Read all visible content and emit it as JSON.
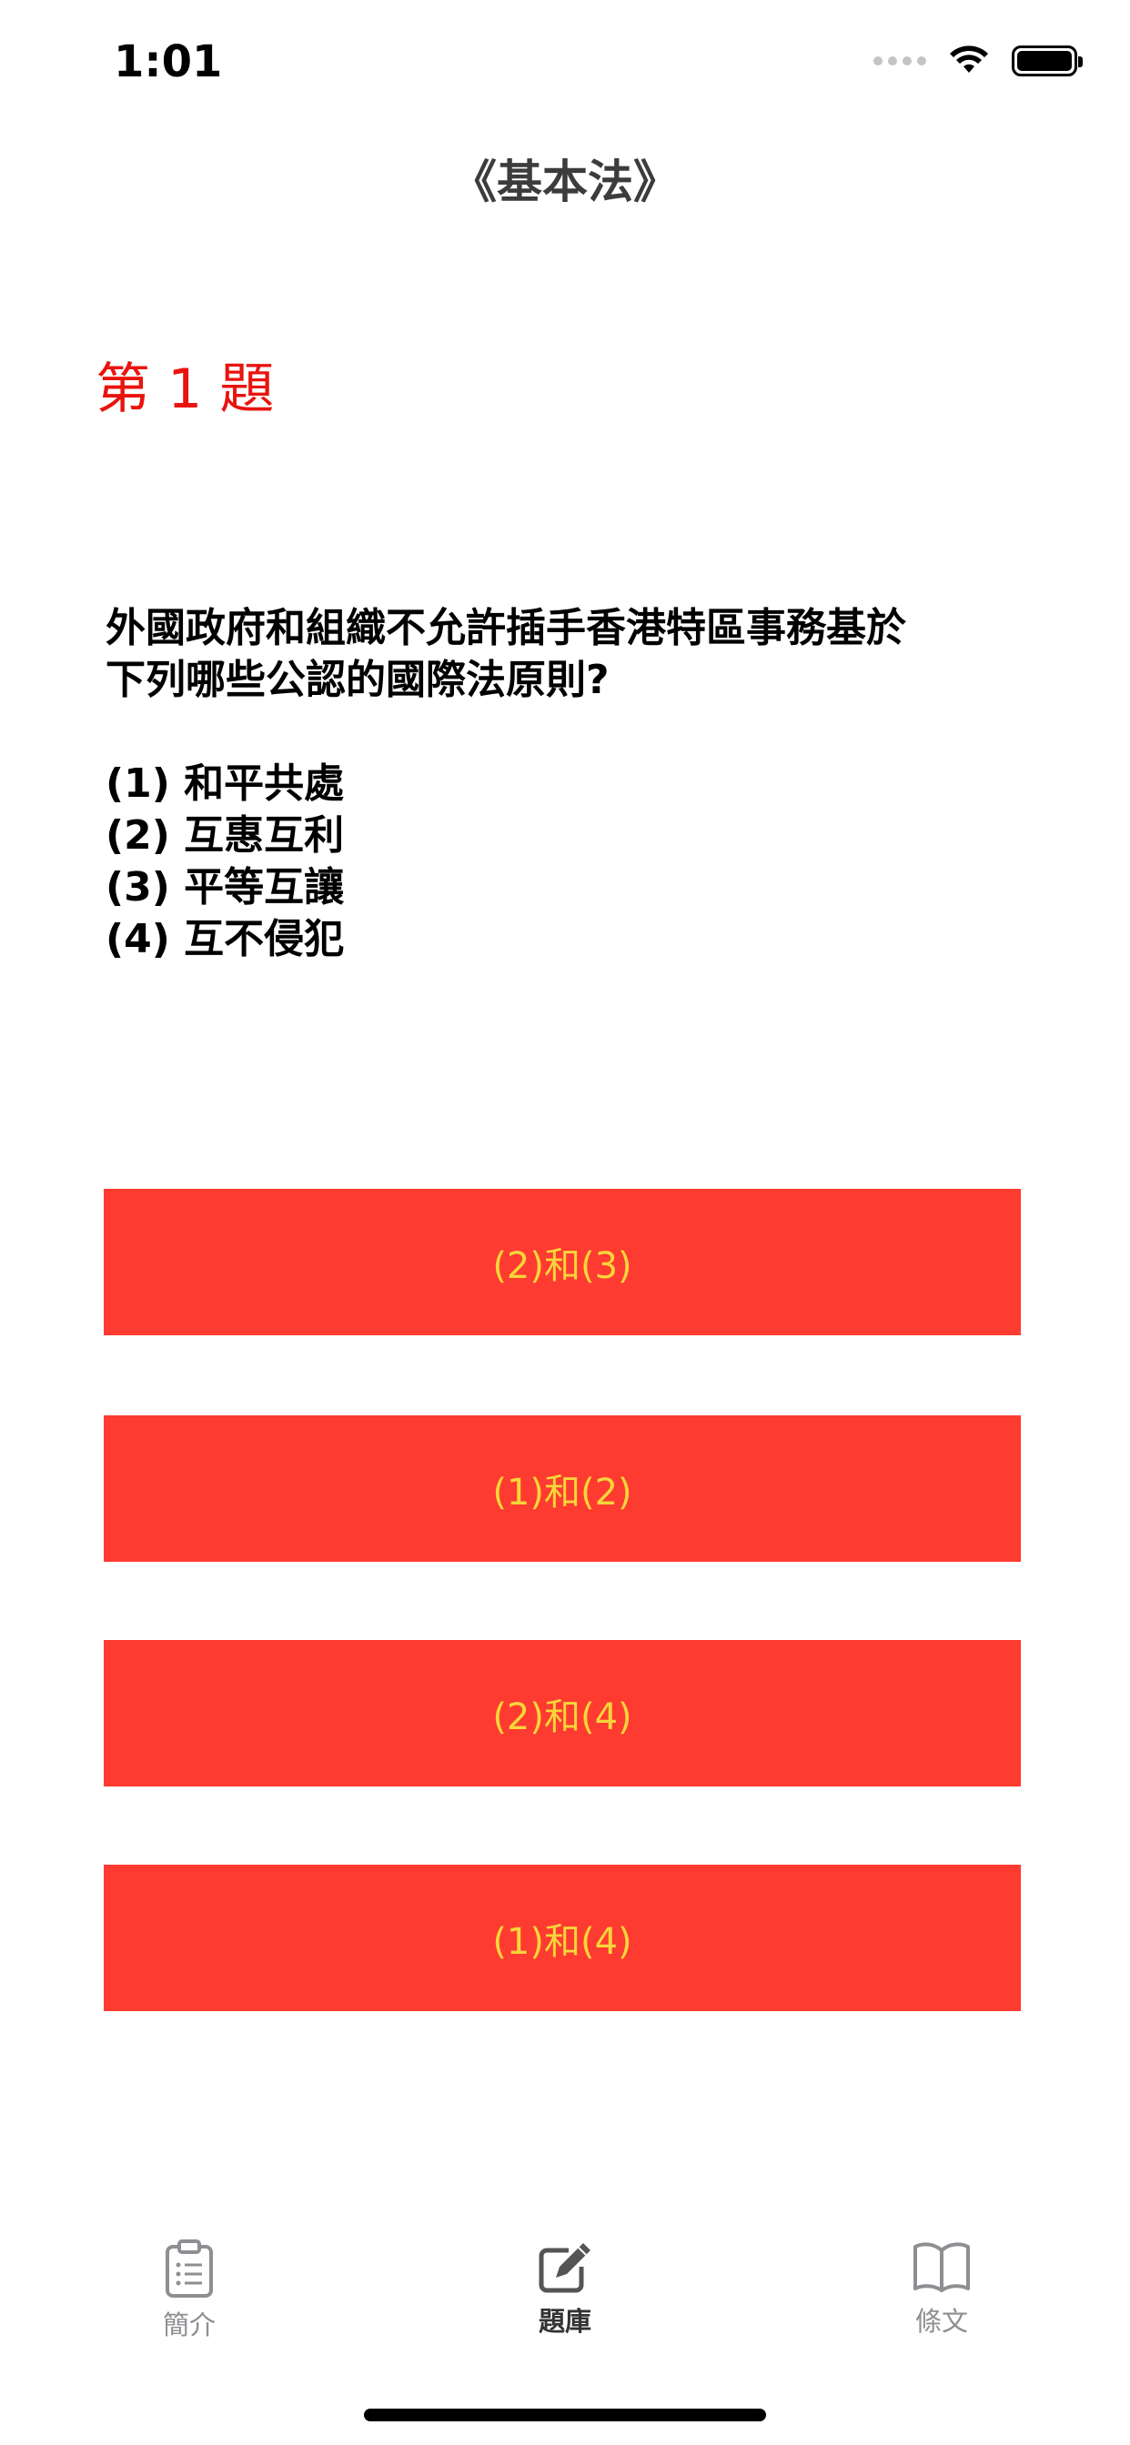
{
  "status_bar": {
    "time": "1:01"
  },
  "nav": {
    "title": "《基本法》"
  },
  "question": {
    "number_label": "第 1 題",
    "lines": [
      "外國政府和組織不允許插手香港特區事務基於",
      "下列哪些公認的國際法原則?"
    ],
    "items": [
      "(1) 和平共處",
      "(2) 互惠互利",
      "(3) 平等互讓",
      "(4) 互不侵犯"
    ]
  },
  "answers": [
    {
      "label": "(2)和(3)"
    },
    {
      "label": "(1)和(2)"
    },
    {
      "label": "(2)和(4)"
    },
    {
      "label": "(1)和(4)"
    }
  ],
  "tab_bar": {
    "tabs": [
      {
        "label": "簡介",
        "icon": "clipboard-icon",
        "active": false
      },
      {
        "label": "題庫",
        "icon": "edit-icon",
        "active": true
      },
      {
        "label": "條文",
        "icon": "book-icon",
        "active": false
      }
    ]
  },
  "colors": {
    "answer_bg": "#fe3b30",
    "answer_text": "#f6d63a",
    "question_number": "#e8140f"
  }
}
